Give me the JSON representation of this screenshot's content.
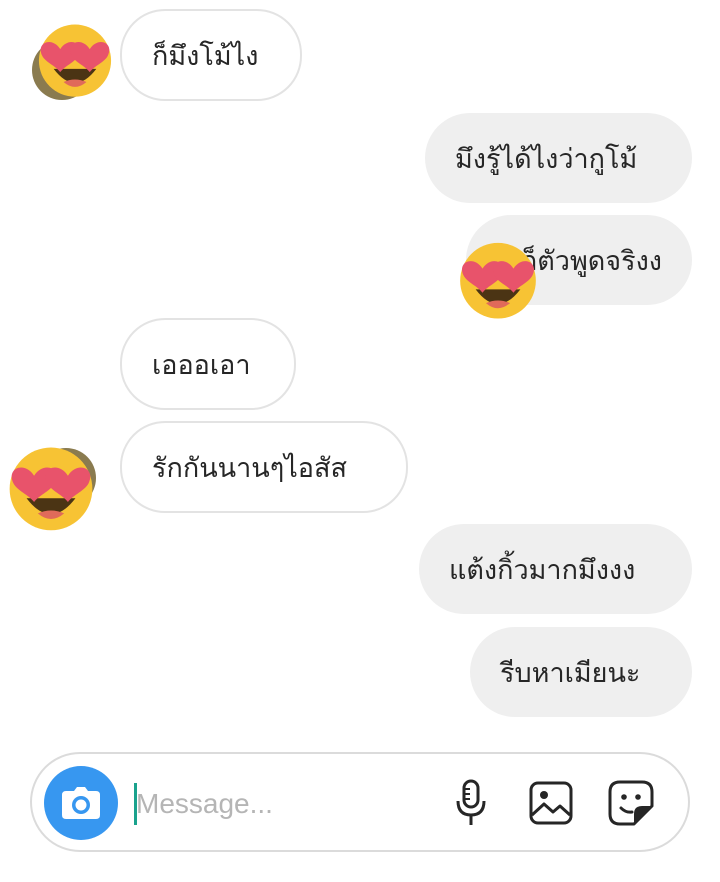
{
  "messages": [
    {
      "side": "in",
      "text": "ก็มึงโม้ไง"
    },
    {
      "side": "out",
      "text": "มึงรู้ได้ไงว่ากูโม้"
    },
    {
      "side": "out",
      "text": "ก็ตัวพูดจริงง"
    },
    {
      "side": "in",
      "text": "เอออเอา"
    },
    {
      "side": "in",
      "text": "รักกันนานๆไอสัส"
    },
    {
      "side": "out",
      "text": "แต้งกิ้วมากมึงงง"
    },
    {
      "side": "out",
      "text": "รีบหาเมียนะ"
    }
  ],
  "composer": {
    "placeholder": "Message...",
    "camera_icon": "camera-icon",
    "mic_icon": "microphone-icon",
    "gallery_icon": "image-icon",
    "sticker_icon": "sticker-icon"
  },
  "colors": {
    "accent": "#3797f0",
    "incoming_border": "#e3e3e3",
    "outgoing_bg": "#efefef",
    "emoji_face": "#f7c334",
    "emoji_heart": "#e8536b"
  },
  "overlay_emoji": "smiling-face-with-heart-eyes"
}
